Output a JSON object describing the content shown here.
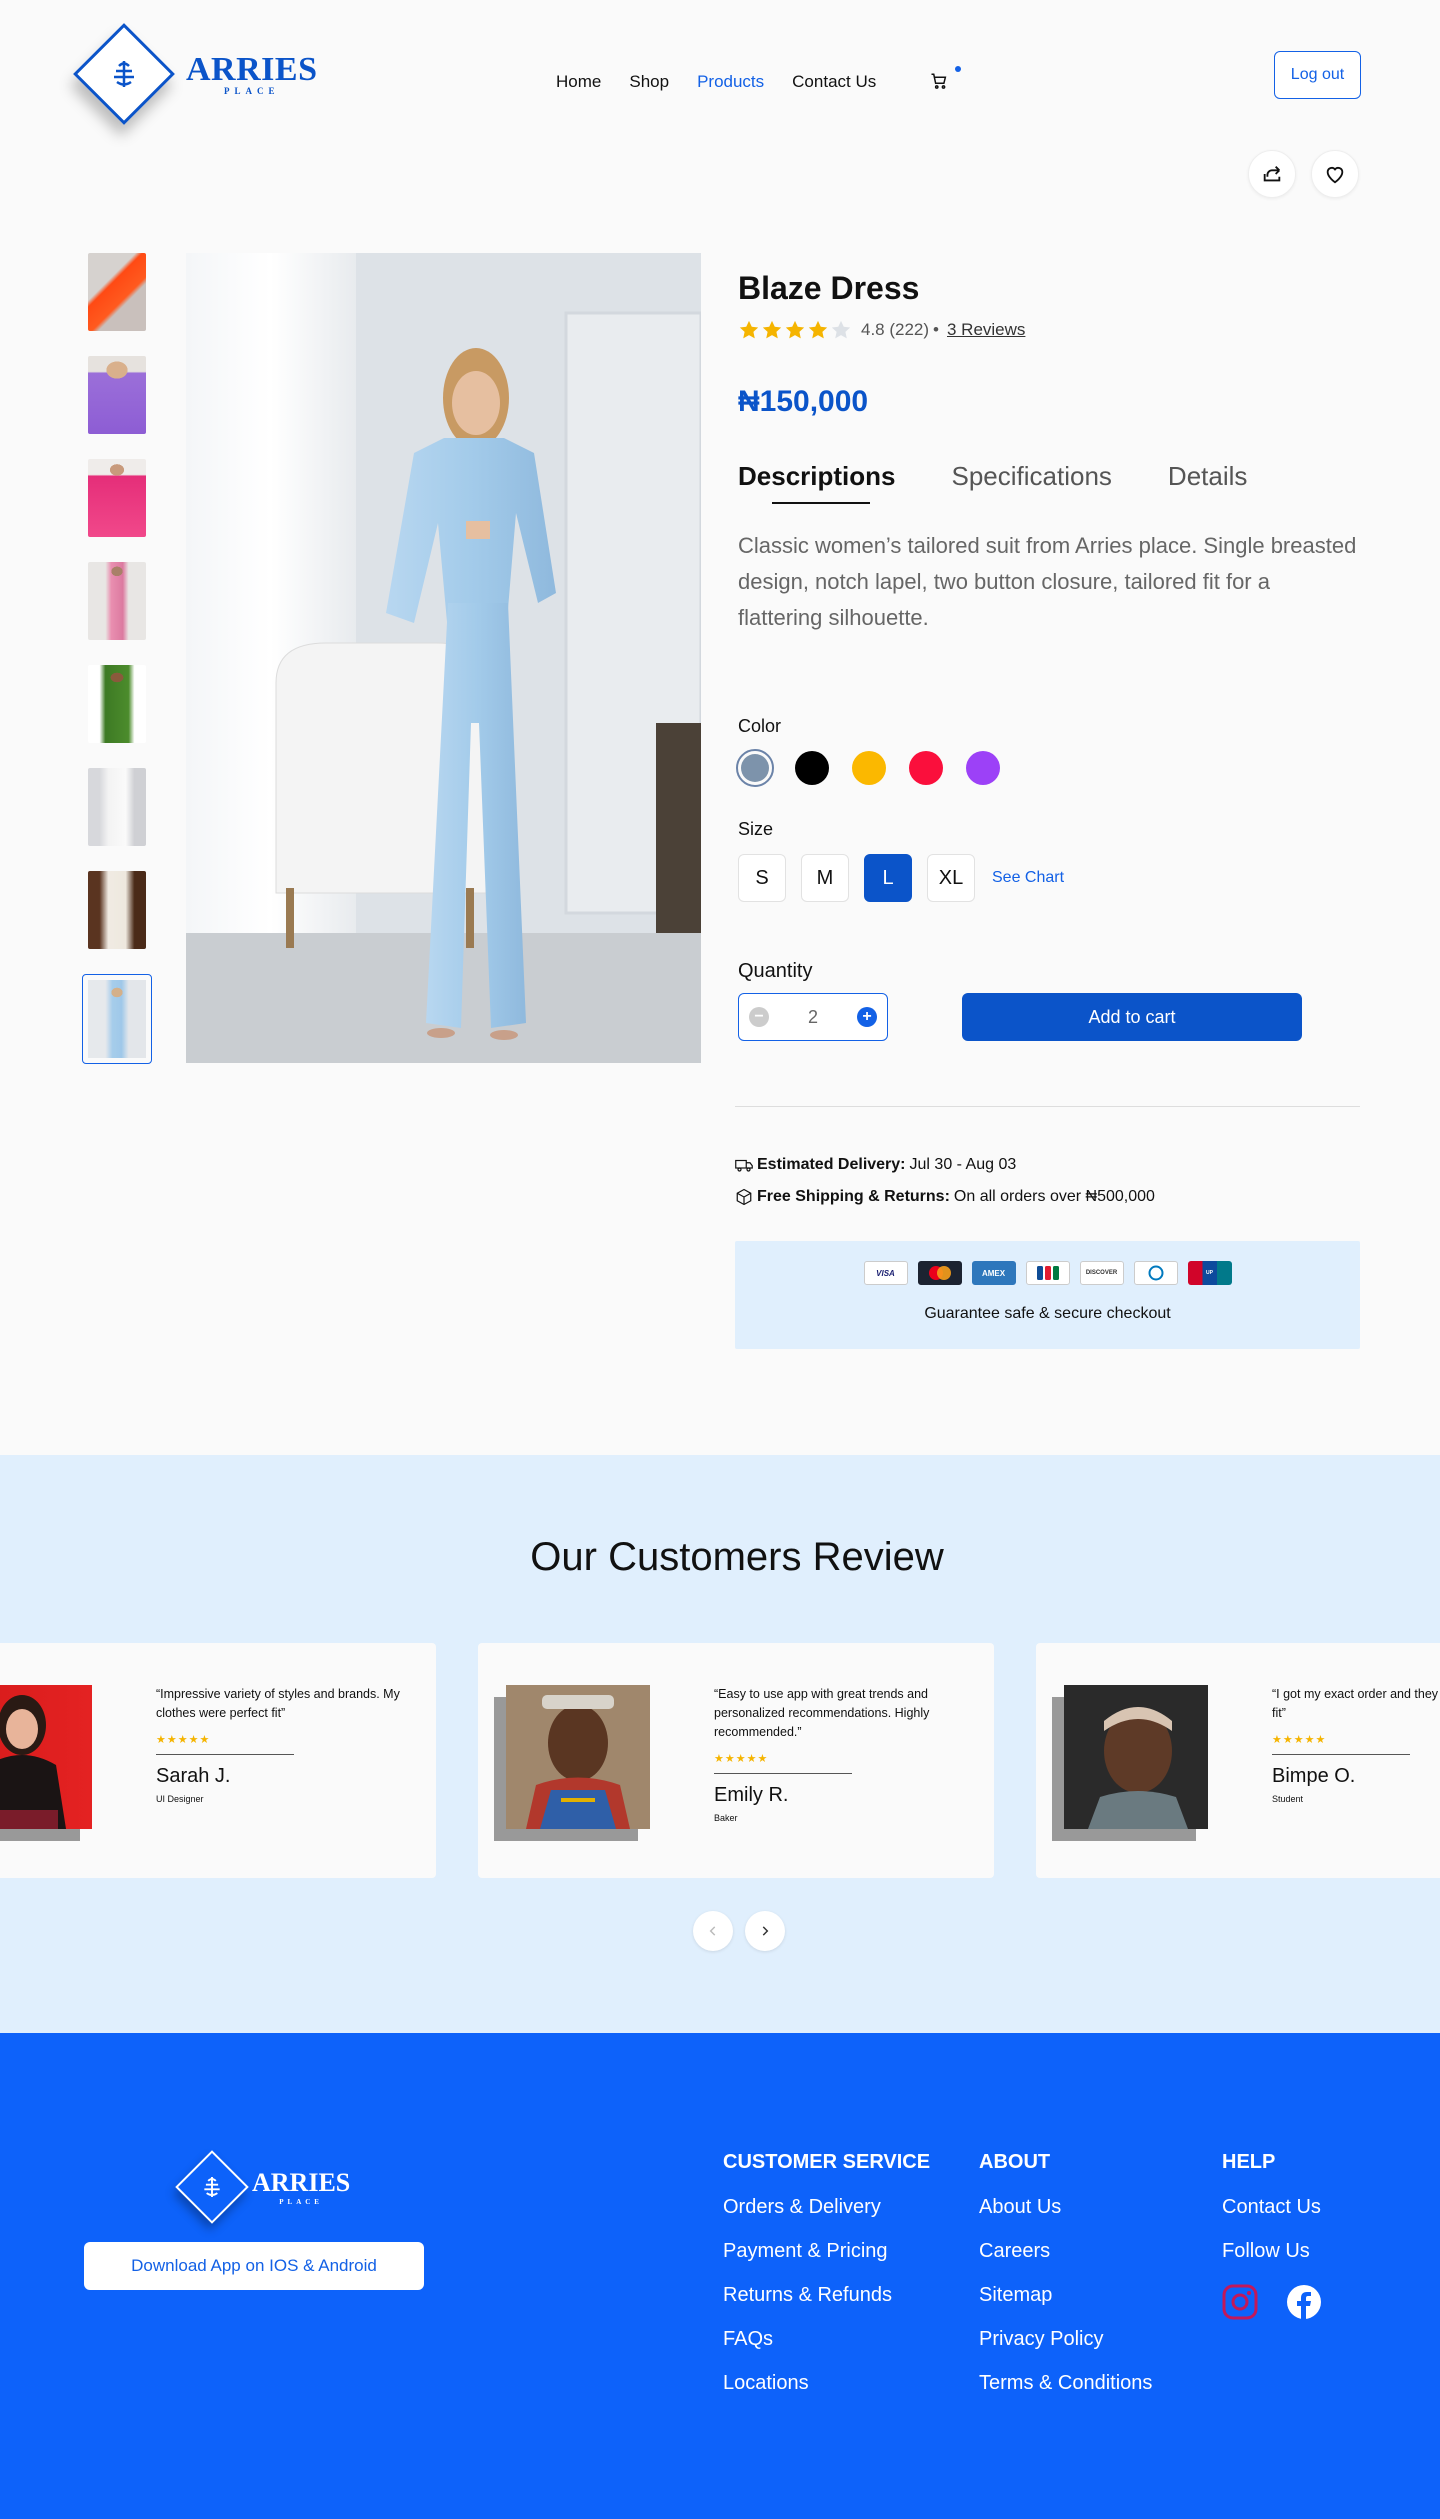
{
  "brand": {
    "name": "ARRIES",
    "tagline": "PLACE"
  },
  "nav": {
    "items": [
      "Home",
      "Shop",
      "Products",
      "Contact Us"
    ],
    "active": "Products"
  },
  "header": {
    "logout_label": "Log out"
  },
  "product": {
    "title": "Blaze Dress",
    "rating_value": "4.8 (222)",
    "rating_stars": 4,
    "reviews_link": "3 Reviews",
    "price": "₦150,000",
    "tabs": [
      "Descriptions",
      "Specifications",
      "Details"
    ],
    "active_tab": "Descriptions",
    "description": "Classic women’s tailored suit from Arries place. Single breasted design, notch lapel, two button closure, tailored fit for a flattering silhouette.",
    "color_label": "Color",
    "colors": [
      "#7d93ab",
      "#000000",
      "#fbb800",
      "#fa0f3c",
      "#9c41f7"
    ],
    "selected_color": "#7d93ab",
    "size_label": "Size",
    "sizes": [
      "S",
      "M",
      "L",
      "XL"
    ],
    "selected_size": "L",
    "see_chart": "See Chart",
    "quantity_label": "Quantity",
    "quantity": "2",
    "add_to_cart": "Add to cart"
  },
  "delivery": {
    "estimated_label": "Estimated Delivery:",
    "estimated_value": "Jul 30 - Aug 03",
    "shipping_label": "Free Shipping & Returns:",
    "shipping_value": "On all orders over ₦500,000"
  },
  "payment": {
    "cards": [
      "VISA",
      "Mastercard",
      "AMEX",
      "JCB",
      "DISCOVER",
      "Diners",
      "UnionPay"
    ],
    "secure_text": "Guarantee safe & secure checkout"
  },
  "reviews": {
    "title": "Our Customers Review",
    "items": [
      {
        "quote": "“Impressive variety of styles and brands. My clothes were perfect fit”",
        "stars": "★★★★★",
        "name": "Sarah J.",
        "role": "UI Designer"
      },
      {
        "quote": "“Easy to use app with great trends and personalized recommendations. Highly recommended.”",
        "stars": "★★★★★",
        "name": "Emily R.",
        "role": "Baker"
      },
      {
        "quote": "“I got my exact order and they were perfect fit”",
        "stars": "★★★★★",
        "name": "Bimpe O.",
        "role": "Student"
      }
    ]
  },
  "footer": {
    "download_label": "Download App on IOS & Android",
    "customer_service": {
      "title": "CUSTOMER SERVICE",
      "links": [
        "Orders & Delivery",
        "Payment & Pricing",
        "Returns & Refunds",
        "FAQs",
        "Locations"
      ]
    },
    "about": {
      "title": "ABOUT",
      "links": [
        "About Us",
        "Careers",
        "Sitemap",
        "Privacy Policy",
        "Terms & Conditions"
      ]
    },
    "help": {
      "title": "HELP",
      "links": [
        "Contact Us",
        "Follow Us"
      ]
    },
    "social_icons": [
      "instagram-icon",
      "facebook-icon"
    ]
  }
}
